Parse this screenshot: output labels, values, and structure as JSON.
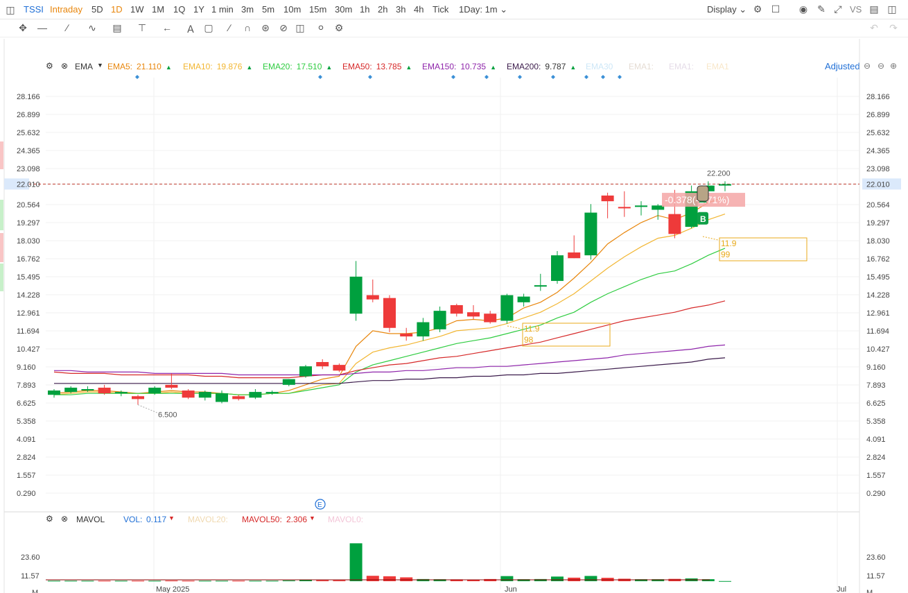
{
  "toolbar": {
    "symbol": "TSSI",
    "intervals": [
      "Intraday",
      "5D",
      "1D",
      "1W",
      "1M",
      "1Q",
      "1Y",
      "1 min",
      "3m",
      "5m",
      "10m",
      "15m",
      "30m",
      "1h",
      "2h",
      "3h",
      "4h",
      "Tick"
    ],
    "active_interval": "1D",
    "range_select": "1Day: 1m",
    "display_label": "Display",
    "vs_label": "VS"
  },
  "indicator": {
    "name": "EMA",
    "items": [
      {
        "label": "EMA5:",
        "value": "21.110",
        "color": "#e8860c"
      },
      {
        "label": "EMA10:",
        "value": "19.876",
        "color": "#f2b632"
      },
      {
        "label": "EMA20:",
        "value": "17.510",
        "color": "#2ecc40"
      },
      {
        "label": "EMA50:",
        "value": "13.785",
        "color": "#d62828"
      },
      {
        "label": "EMA150:",
        "value": "10.735",
        "color": "#8e24aa"
      },
      {
        "label": "EMA200:",
        "value": "9.787",
        "color": "#3a1a4a"
      }
    ],
    "faded": [
      "EMA30",
      "EMA1:",
      "EMA1:",
      "EMA1"
    ],
    "adjusted_label": "Adjusted"
  },
  "mavol": {
    "name": "MAVOL",
    "vol_label": "VOL:",
    "vol_value": "0.117",
    "mavol20": "MAVOL20:",
    "mavol50_label": "MAVOL50:",
    "mavol50_value": "2.306",
    "mavol0": "MAVOL0:"
  },
  "colors": {
    "up": "#00a03e",
    "down": "#ee3a3a",
    "accent": "#e8860c",
    "blue": "#1f6fd6"
  },
  "chart_data": {
    "type": "candlestick",
    "y_ticks": [
      "28.166",
      "26.899",
      "25.632",
      "24.365",
      "23.098",
      "22.010",
      "20.564",
      "19.297",
      "18.030",
      "16.762",
      "15.495",
      "14.228",
      "12.961",
      "11.694",
      "10.427",
      "9.160",
      "7.893",
      "6.625",
      "5.358",
      "4.091",
      "2.824",
      "1.557",
      "0.290"
    ],
    "ylim": [
      0.29,
      28.166
    ],
    "x_labels": [
      "May 2025",
      "Jun",
      "Jul"
    ],
    "last_price": "22.010",
    "high_label": "22.200",
    "low_label": "6.500",
    "change_label": "-0.378(-1.71%)",
    "buy_marker": "B",
    "event_marker": "E",
    "annotations": [
      {
        "line1": "11.9",
        "line2": "98"
      },
      {
        "line1": "11.9",
        "line2": "99"
      }
    ],
    "candles": [
      {
        "o": 7.2,
        "h": 7.6,
        "l": 7.0,
        "c": 7.5
      },
      {
        "o": 7.4,
        "h": 7.8,
        "l": 7.3,
        "c": 7.7
      },
      {
        "o": 7.5,
        "h": 7.8,
        "l": 7.4,
        "c": 7.6
      },
      {
        "o": 7.7,
        "h": 7.9,
        "l": 7.2,
        "c": 7.3
      },
      {
        "o": 7.3,
        "h": 7.5,
        "l": 7.1,
        "c": 7.4
      },
      {
        "o": 7.1,
        "h": 7.2,
        "l": 6.5,
        "c": 6.9
      },
      {
        "o": 7.3,
        "h": 7.8,
        "l": 7.2,
        "c": 7.7
      },
      {
        "o": 7.9,
        "h": 8.7,
        "l": 7.6,
        "c": 7.7
      },
      {
        "o": 7.5,
        "h": 7.6,
        "l": 6.9,
        "c": 7.0
      },
      {
        "o": 7.0,
        "h": 7.5,
        "l": 6.8,
        "c": 7.4
      },
      {
        "o": 6.7,
        "h": 7.5,
        "l": 6.6,
        "c": 7.3
      },
      {
        "o": 7.1,
        "h": 7.2,
        "l": 6.8,
        "c": 6.9
      },
      {
        "o": 7.0,
        "h": 7.6,
        "l": 6.9,
        "c": 7.4
      },
      {
        "o": 7.3,
        "h": 7.5,
        "l": 7.2,
        "c": 7.4
      },
      {
        "o": 7.9,
        "h": 8.3,
        "l": 7.8,
        "c": 8.3
      },
      {
        "o": 8.5,
        "h": 9.3,
        "l": 8.4,
        "c": 9.2
      },
      {
        "o": 9.5,
        "h": 9.7,
        "l": 9.0,
        "c": 9.2
      },
      {
        "o": 9.3,
        "h": 9.4,
        "l": 8.8,
        "c": 8.9
      },
      {
        "o": 12.9,
        "h": 16.6,
        "l": 12.4,
        "c": 15.5
      },
      {
        "o": 14.2,
        "h": 15.3,
        "l": 13.7,
        "c": 13.9
      },
      {
        "o": 14.0,
        "h": 14.2,
        "l": 11.6,
        "c": 11.9
      },
      {
        "o": 11.5,
        "h": 11.9,
        "l": 11.0,
        "c": 11.3
      },
      {
        "o": 11.3,
        "h": 12.6,
        "l": 11.0,
        "c": 12.3
      },
      {
        "o": 11.8,
        "h": 13.4,
        "l": 11.6,
        "c": 13.1
      },
      {
        "o": 13.5,
        "h": 13.6,
        "l": 12.7,
        "c": 12.9
      },
      {
        "o": 13.0,
        "h": 13.5,
        "l": 12.5,
        "c": 12.7
      },
      {
        "o": 12.9,
        "h": 13.1,
        "l": 12.2,
        "c": 12.3
      },
      {
        "o": 12.4,
        "h": 14.3,
        "l": 12.2,
        "c": 14.2
      },
      {
        "o": 13.7,
        "h": 14.3,
        "l": 13.4,
        "c": 14.1
      },
      {
        "o": 14.8,
        "h": 15.7,
        "l": 14.5,
        "c": 14.9
      },
      {
        "o": 15.2,
        "h": 17.3,
        "l": 15.0,
        "c": 17.0
      },
      {
        "o": 17.2,
        "h": 18.4,
        "l": 16.8,
        "c": 16.8
      },
      {
        "o": 17.0,
        "h": 20.6,
        "l": 16.7,
        "c": 20.0
      },
      {
        "o": 21.2,
        "h": 21.4,
        "l": 19.6,
        "c": 20.8
      },
      {
        "o": 20.4,
        "h": 21.5,
        "l": 19.7,
        "c": 20.3
      },
      {
        "o": 20.4,
        "h": 20.8,
        "l": 19.8,
        "c": 20.5
      },
      {
        "o": 20.2,
        "h": 20.6,
        "l": 19.5,
        "c": 20.5
      },
      {
        "o": 19.9,
        "h": 21.6,
        "l": 18.2,
        "c": 18.5
      },
      {
        "o": 19.0,
        "h": 21.9,
        "l": 18.9,
        "c": 21.5
      },
      {
        "o": 21.5,
        "h": 22.2,
        "l": 21.3,
        "c": 21.9
      },
      {
        "o": 21.9,
        "h": 22.2,
        "l": 21.5,
        "c": 22.0
      }
    ],
    "ema": [
      {
        "name": "EMA5",
        "values": [
          7.3,
          7.4,
          7.5,
          7.5,
          7.4,
          7.3,
          7.4,
          7.5,
          7.4,
          7.4,
          7.3,
          7.2,
          7.2,
          7.3,
          7.5,
          7.9,
          8.3,
          8.5,
          10.6,
          11.7,
          11.5,
          11.5,
          11.6,
          11.9,
          12.4,
          12.5,
          12.4,
          12.6,
          13.3,
          13.7,
          14.4,
          15.4,
          16.5,
          17.8,
          18.6,
          19.3,
          19.8,
          19.5,
          20.0,
          20.7,
          21.1
        ]
      },
      {
        "name": "EMA10",
        "values": [
          7.2,
          7.3,
          7.4,
          7.4,
          7.3,
          7.3,
          7.3,
          7.4,
          7.3,
          7.3,
          7.3,
          7.2,
          7.2,
          7.3,
          7.3,
          7.6,
          7.9,
          8.0,
          9.4,
          10.2,
          10.5,
          10.7,
          11.0,
          11.3,
          11.7,
          11.8,
          11.9,
          12.2,
          12.6,
          13.0,
          13.6,
          14.3,
          15.2,
          16.1,
          16.9,
          17.6,
          18.2,
          18.4,
          18.9,
          19.5,
          19.9
        ]
      },
      {
        "name": "EMA20",
        "values": [
          7.2,
          7.2,
          7.3,
          7.3,
          7.3,
          7.3,
          7.3,
          7.3,
          7.3,
          7.3,
          7.3,
          7.2,
          7.2,
          7.3,
          7.3,
          7.5,
          7.7,
          7.9,
          8.8,
          9.3,
          9.6,
          9.9,
          10.2,
          10.5,
          10.8,
          11.0,
          11.2,
          11.5,
          11.8,
          12.1,
          12.6,
          13.0,
          13.7,
          14.3,
          14.8,
          15.3,
          15.7,
          15.9,
          16.4,
          17.0,
          17.5
        ]
      },
      {
        "name": "EMA50",
        "values": [
          8.8,
          8.7,
          8.7,
          8.7,
          8.6,
          8.6,
          8.6,
          8.6,
          8.6,
          8.5,
          8.5,
          8.4,
          8.4,
          8.4,
          8.4,
          8.5,
          8.6,
          8.6,
          8.9,
          9.1,
          9.3,
          9.4,
          9.6,
          9.8,
          9.9,
          10.1,
          10.3,
          10.5,
          10.7,
          10.9,
          11.2,
          11.5,
          11.8,
          12.1,
          12.4,
          12.6,
          12.8,
          13.0,
          13.3,
          13.5,
          13.8
        ]
      },
      {
        "name": "EMA150",
        "values": [
          8.9,
          8.9,
          8.8,
          8.8,
          8.8,
          8.8,
          8.7,
          8.7,
          8.7,
          8.7,
          8.7,
          8.6,
          8.6,
          8.6,
          8.6,
          8.6,
          8.6,
          8.6,
          8.7,
          8.8,
          8.8,
          8.9,
          8.9,
          9.0,
          9.1,
          9.1,
          9.2,
          9.2,
          9.3,
          9.4,
          9.5,
          9.6,
          9.7,
          9.8,
          10.0,
          10.1,
          10.2,
          10.3,
          10.4,
          10.6,
          10.7
        ]
      },
      {
        "name": "EMA200",
        "values": [
          8.0,
          8.0,
          8.0,
          8.0,
          8.0,
          8.0,
          8.0,
          8.0,
          8.0,
          8.0,
          8.0,
          8.0,
          8.0,
          8.0,
          8.0,
          8.0,
          8.0,
          8.0,
          8.1,
          8.2,
          8.2,
          8.3,
          8.3,
          8.4,
          8.4,
          8.5,
          8.5,
          8.6,
          8.6,
          8.7,
          8.7,
          8.8,
          8.9,
          9.0,
          9.1,
          9.2,
          9.3,
          9.4,
          9.5,
          9.7,
          9.8
        ]
      }
    ],
    "volume_ticks": [
      "23.60",
      "11.57",
      "M"
    ],
    "volume_ylim": [
      0,
      26
    ],
    "volume": [
      0.3,
      0.3,
      0.3,
      0.3,
      0.3,
      0.3,
      0.3,
      0.4,
      0.3,
      0.3,
      0.3,
      0.3,
      0.3,
      0.3,
      0.5,
      0.8,
      0.6,
      0.6,
      24.5,
      3.5,
      3.2,
      2.5,
      1.4,
      1.3,
      1.2,
      1.1,
      1.4,
      3.3,
      1.3,
      1.4,
      3.0,
      2.3,
      3.4,
      2.2,
      1.6,
      1.3,
      1.3,
      1.5,
      1.8,
      1.3,
      0.1
    ]
  }
}
